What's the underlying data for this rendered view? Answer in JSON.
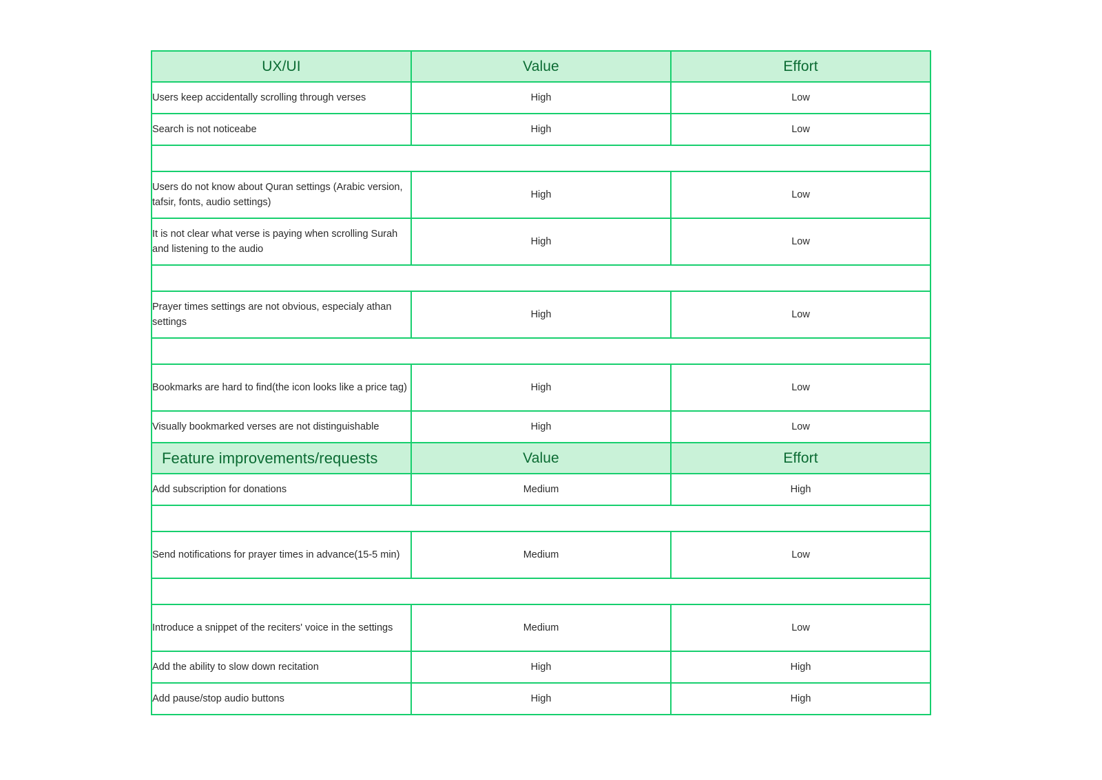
{
  "theme": {
    "border_color": "#17cf6e",
    "header_fill": "#c9f2d8",
    "header_text": "#0b6b33",
    "body_text": "#2b2b2b",
    "page_background": "#ffffff"
  },
  "table": {
    "columns": [
      "UX/UI",
      "Value",
      "Effort"
    ],
    "sections": [
      {
        "header": {
          "item": "UX/UI",
          "value": "Value",
          "effort": "Effort",
          "align": "center"
        },
        "groups": [
          {
            "rows": [
              {
                "item": "Users keep accidentally scrolling through verses",
                "value": "High",
                "effort": "Low",
                "lines": 1
              },
              {
                "item": "Search is not noticeabe",
                "value": "High",
                "effort": "Low",
                "lines": 1
              }
            ]
          },
          {
            "rows": [
              {
                "item": "Users do not know about Quran settings (Arabic version, tafsir, fonts, audio settings)",
                "value": "High",
                "effort": "Low",
                "lines": 2
              },
              {
                "item": "It is not clear what verse is paying when scrolling Surah and listening to the audio",
                "value": "High",
                "effort": "Low",
                "lines": 2
              }
            ]
          },
          {
            "rows": [
              {
                "item": "Prayer times settings are not obvious, especialy athan settings",
                "value": "High",
                "effort": "Low",
                "lines": 2
              }
            ]
          },
          {
            "rows": [
              {
                "item": "Bookmarks are hard to find(the icon looks like a price tag)",
                "value": "High",
                "effort": "Low",
                "lines": 2
              },
              {
                "item": "Visually bookmarked verses are not distinguishable",
                "value": "High",
                "effort": "Low",
                "lines": 1
              }
            ]
          }
        ]
      },
      {
        "header": {
          "item": "Feature improvements/requests",
          "value": "Value",
          "effort": "Effort",
          "align": "left"
        },
        "groups": [
          {
            "rows": [
              {
                "item": "Add subscription for donations",
                "value": "Medium",
                "effort": "High",
                "lines": 1
              }
            ]
          },
          {
            "rows": [
              {
                "item": "Send notifications for prayer times in advance(15-5 min)",
                "value": "Medium",
                "effort": "Low",
                "lines": 2
              }
            ]
          },
          {
            "rows": [
              {
                "item": "Introduce a snippet of the reciters' voice in the settings",
                "value": "Medium",
                "effort": "Low",
                "lines": 2
              },
              {
                "item": "Add the ability to slow down recitation",
                "value": "High",
                "effort": "High",
                "lines": 1
              },
              {
                "item": "Add pause/stop audio buttons",
                "value": "High",
                "effort": "High",
                "lines": 1
              }
            ]
          }
        ]
      }
    ]
  }
}
